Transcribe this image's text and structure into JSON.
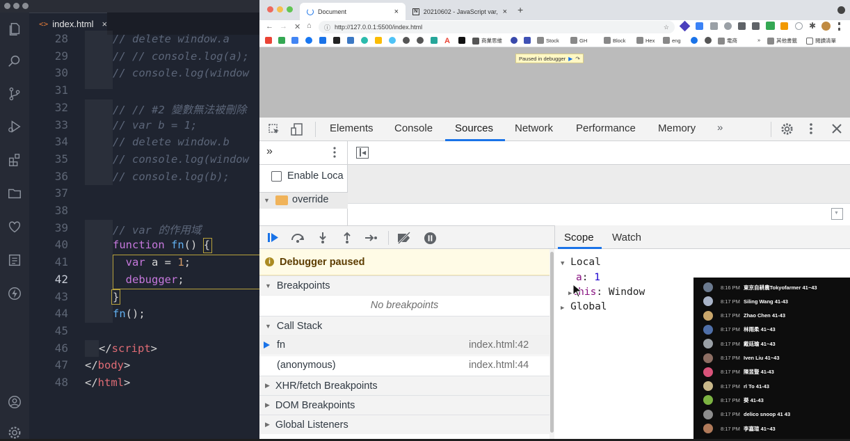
{
  "vscode": {
    "tab_icon": "<>",
    "tab_label": "index.html",
    "tab_close": "×",
    "lines": [
      {
        "n": "28",
        "parts": [
          [
            "cm",
            "// delete window.a"
          ]
        ]
      },
      {
        "n": "29",
        "parts": [
          [
            "cm",
            "// // console.log(a);"
          ]
        ]
      },
      {
        "n": "30",
        "parts": [
          [
            "cm",
            "// console.log(window"
          ]
        ]
      },
      {
        "n": "31",
        "parts": []
      },
      {
        "n": "32",
        "parts": [
          [
            "cm",
            "// // #2 變數無法被刪除"
          ]
        ]
      },
      {
        "n": "33",
        "parts": [
          [
            "cm",
            "// var b = 1;"
          ]
        ]
      },
      {
        "n": "34",
        "parts": [
          [
            "cm",
            "// delete window.b"
          ]
        ]
      },
      {
        "n": "35",
        "parts": [
          [
            "cm",
            "// console.log(window"
          ]
        ]
      },
      {
        "n": "36",
        "parts": [
          [
            "cm",
            "// console.log(b);"
          ]
        ]
      },
      {
        "n": "37",
        "parts": []
      },
      {
        "n": "38",
        "parts": []
      },
      {
        "n": "39",
        "parts": [
          [
            "cm",
            "// var 的作用域"
          ]
        ]
      },
      {
        "n": "40",
        "parts": [
          [
            "kw",
            "function "
          ],
          [
            "fn",
            "fn"
          ],
          [
            "punc",
            "() {"
          ]
        ]
      },
      {
        "n": "41",
        "parts": [
          [
            "punc",
            "  "
          ],
          [
            "kw",
            "var"
          ],
          [
            "punc",
            " a = "
          ],
          [
            "num",
            "1"
          ],
          [
            "punc",
            ";"
          ]
        ]
      },
      {
        "n": "42",
        "parts": [
          [
            "punc",
            "  "
          ],
          [
            "kw",
            "debugger"
          ],
          [
            "punc",
            ";"
          ]
        ]
      },
      {
        "n": "43",
        "parts": [
          [
            "punc",
            "}"
          ]
        ]
      },
      {
        "n": "44",
        "parts": [
          [
            "fn",
            "fn"
          ],
          [
            "punc",
            "();"
          ]
        ]
      },
      {
        "n": "45",
        "parts": []
      },
      {
        "n": "46",
        "parts": [
          [
            "punc",
            "</"
          ],
          [
            "tag",
            "script"
          ],
          [
            "punc",
            ">"
          ]
        ]
      },
      {
        "n": "47",
        "parts": [
          [
            "punc",
            "</"
          ],
          [
            "tag",
            "body"
          ],
          [
            "punc",
            ">"
          ]
        ]
      },
      {
        "n": "48",
        "parts": [
          [
            "punc",
            "</"
          ],
          [
            "tag",
            "html"
          ],
          [
            "punc",
            ">"
          ]
        ]
      }
    ],
    "active_line": "42"
  },
  "chrome": {
    "tabs": [
      {
        "label": "Document",
        "close": "×"
      },
      {
        "label": "20210602 - JavaScript var, le",
        "close": "×"
      }
    ],
    "new_tab": "+",
    "url": "http://127.0.0.1:5500/index.html",
    "bookmarks": [
      "商業思維",
      "Stock",
      "GH",
      "Block",
      "Hex",
      "eng",
      "電商"
    ],
    "bookmarks_more": "»",
    "bookmarks_other": "其他書籤",
    "reading_list": "閱讀清單",
    "paused_badge": "Paused in debugger"
  },
  "devtools": {
    "tabs": [
      "Elements",
      "Console",
      "Sources",
      "Network",
      "Performance",
      "Memory"
    ],
    "more_tabs": "»",
    "selected_tab": "Sources",
    "nav_more": "»",
    "enable_local": "Enable Loca",
    "override_folder": "override",
    "debugger_paused": "Debugger paused",
    "breakpoints_title": "Breakpoints",
    "no_breakpoints": "No breakpoints",
    "call_stack_title": "Call Stack",
    "call_stack": [
      {
        "name": "fn",
        "location": "index.html:42"
      },
      {
        "name": "(anonymous)",
        "location": "index.html:44"
      }
    ],
    "xhr_title": "XHR/fetch Breakpoints",
    "dom_title": "DOM Breakpoints",
    "global_listeners_title": "Global Listeners",
    "scope_tab": "Scope",
    "watch_tab": "Watch",
    "scope_local": "Local",
    "scope_a_key": "a",
    "scope_a_value": "1",
    "scope_this_key": "this",
    "scope_this_value": "Window",
    "scope_global": "Global"
  },
  "chat": [
    {
      "time": "8:16 PM",
      "name": "東京自耕農Tokyofarmer",
      "msg": "41~43",
      "color": "#6b7a8f"
    },
    {
      "time": "8:17 PM",
      "name": "Siling Wang",
      "msg": "41-43",
      "color": "#a9b4c8"
    },
    {
      "time": "8:17 PM",
      "name": "Zhao Chen",
      "msg": "41-43",
      "color": "#c9a66b"
    },
    {
      "time": "8:17 PM",
      "name": "林雨柔",
      "msg": "41~43",
      "color": "#4f6fa8"
    },
    {
      "time": "8:17 PM",
      "name": "戴廷瑜",
      "msg": "41~43",
      "color": "#9aa0a6"
    },
    {
      "time": "8:17 PM",
      "name": "Iven Liu",
      "msg": "41~43",
      "color": "#8d6e63"
    },
    {
      "time": "8:17 PM",
      "name": "陳昱豎",
      "msg": "41-43",
      "color": "#d9537a"
    },
    {
      "time": "8:17 PM",
      "name": "rl To",
      "msg": "41-43",
      "color": "#c8b88a"
    },
    {
      "time": "8:17 PM",
      "name": "葵",
      "msg": "41-43",
      "color": "#7cb342"
    },
    {
      "time": "8:17 PM",
      "name": "delico snoop",
      "msg": "41 43",
      "color": "#8d8d8d"
    },
    {
      "time": "8:17 PM",
      "name": "李嘉瑄",
      "msg": "41~43",
      "color": "#b07a5a"
    }
  ]
}
